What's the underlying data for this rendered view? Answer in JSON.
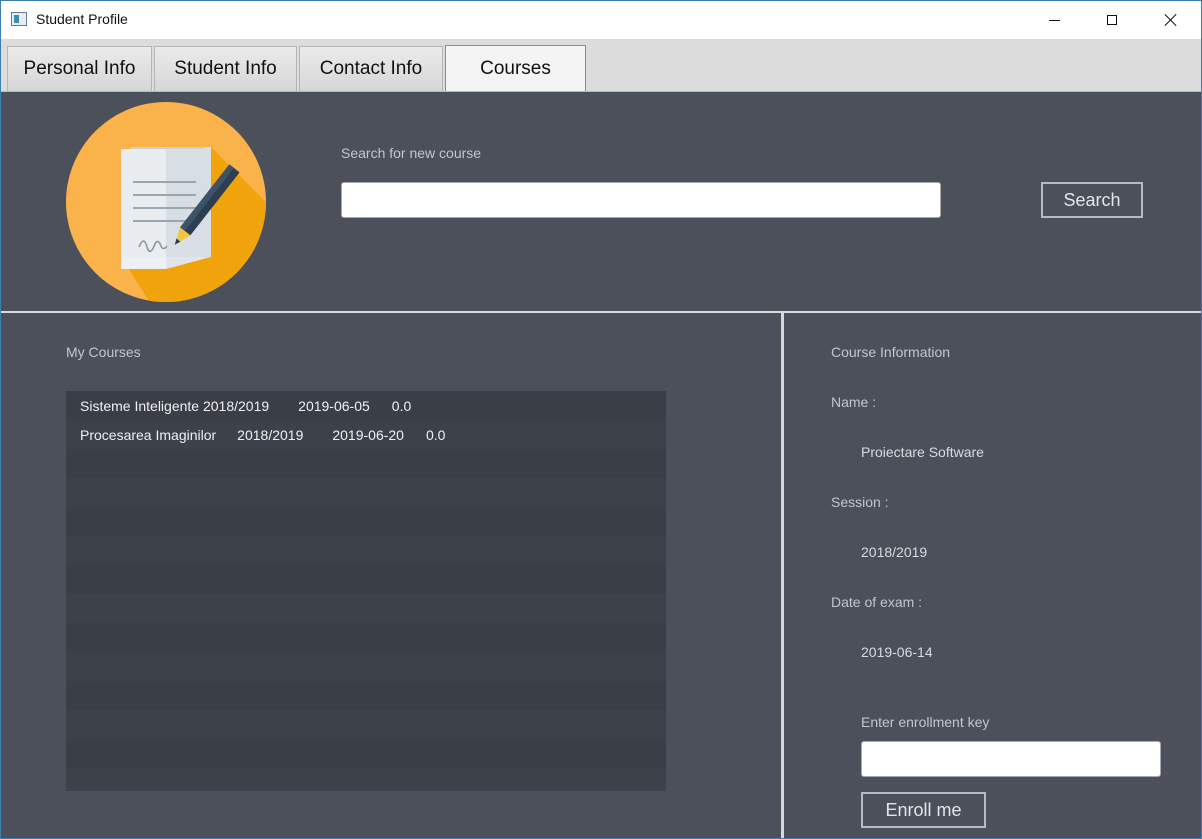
{
  "window": {
    "title": "Student Profile",
    "accent_color": "#4b9fd0",
    "panel_color": "#4b505b"
  },
  "tabs": [
    {
      "label": "Personal Info",
      "active": false
    },
    {
      "label": "Student Info",
      "active": false
    },
    {
      "label": "Contact Info",
      "active": false
    },
    {
      "label": "Courses",
      "active": true
    }
  ],
  "search": {
    "label": "Search for new course",
    "value": "",
    "button_label": "Search"
  },
  "logo": {
    "icon": "document-pen-icon",
    "circle_color": "#f9b34a",
    "shadow_color": "#f0a30a"
  },
  "my_courses": {
    "label": "My Courses",
    "rows": [
      {
        "name": "Sisteme Inteligente",
        "session": "2018/2019",
        "date": "2019-06-05",
        "grade": "0.0"
      },
      {
        "name": "Procesarea Imaginilor",
        "session": "2018/2019",
        "date": "2019-06-20",
        "grade": "0.0"
      }
    ]
  },
  "course_info": {
    "label": "Course Information",
    "name_label": "Name :",
    "name_value": "Proiectare Software",
    "session_label": "Session :",
    "session_value": "2018/2019",
    "date_label": "Date of exam :",
    "date_value": "2019-06-14",
    "key_label": "Enter enrollment key",
    "key_value": "",
    "enroll_button": "Enroll me"
  }
}
